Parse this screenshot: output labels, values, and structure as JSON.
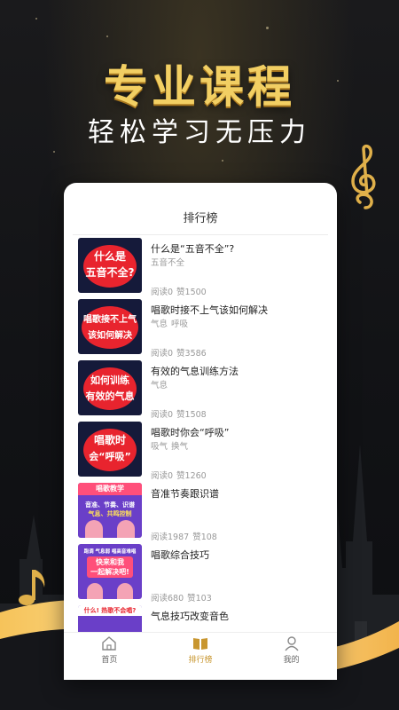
{
  "hero": {
    "headline": "专业课程",
    "subline": "轻松学习无压力"
  },
  "colors": {
    "gold": "#f2cf63",
    "active_tab": "#c8962f"
  },
  "screen": {
    "title": "排行榜"
  },
  "courses": [
    {
      "title": "什么是“五音不全”?",
      "tags": [
        "五音不全"
      ],
      "reads": "阅读0",
      "likes": "赞1500",
      "thumb_lines": [
        "什么是",
        "五音不全?"
      ]
    },
    {
      "title": "唱歌时接不上气该如何解决",
      "tags": [
        "气息",
        "呼吸"
      ],
      "reads": "阅读0",
      "likes": "赞3586",
      "thumb_lines": [
        "唱歌接不上气",
        "该如何解决"
      ]
    },
    {
      "title": "有效的气息训练方法",
      "tags": [
        "气息"
      ],
      "reads": "阅读0",
      "likes": "赞1508",
      "thumb_lines": [
        "如何训练",
        "有效的气息"
      ]
    },
    {
      "title": "唱歌时你会“呼吸”",
      "tags": [
        "吸气",
        "换气"
      ],
      "reads": "阅读0",
      "likes": "赞1260",
      "thumb_lines": [
        "唱歌时",
        "会“呼吸”"
      ]
    },
    {
      "title": "音准节奏跟识谱",
      "tags": [],
      "reads": "阅读1987",
      "likes": "赞108",
      "thumb_lines": [
        "唱歌教学",
        "音准、节奏、识谱",
        "气息、共鸣控制"
      ]
    },
    {
      "title": "唱歌综合技巧",
      "tags": [],
      "reads": "阅读680",
      "likes": "赞103",
      "thumb_lines": [
        "跑调 气息弱 唱高音难唱",
        "快来和我",
        "一起解决吧!"
      ]
    },
    {
      "title": "气息技巧改变音色",
      "tags": [],
      "reads": "",
      "likes": "",
      "thumb_lines": [
        "什么! 热歌不会唱?"
      ]
    }
  ],
  "tabbar": {
    "tabs": [
      {
        "label": "首页",
        "icon": "home-icon"
      },
      {
        "label": "排行榜",
        "icon": "book-icon"
      },
      {
        "label": "我的",
        "icon": "user-icon"
      }
    ]
  }
}
